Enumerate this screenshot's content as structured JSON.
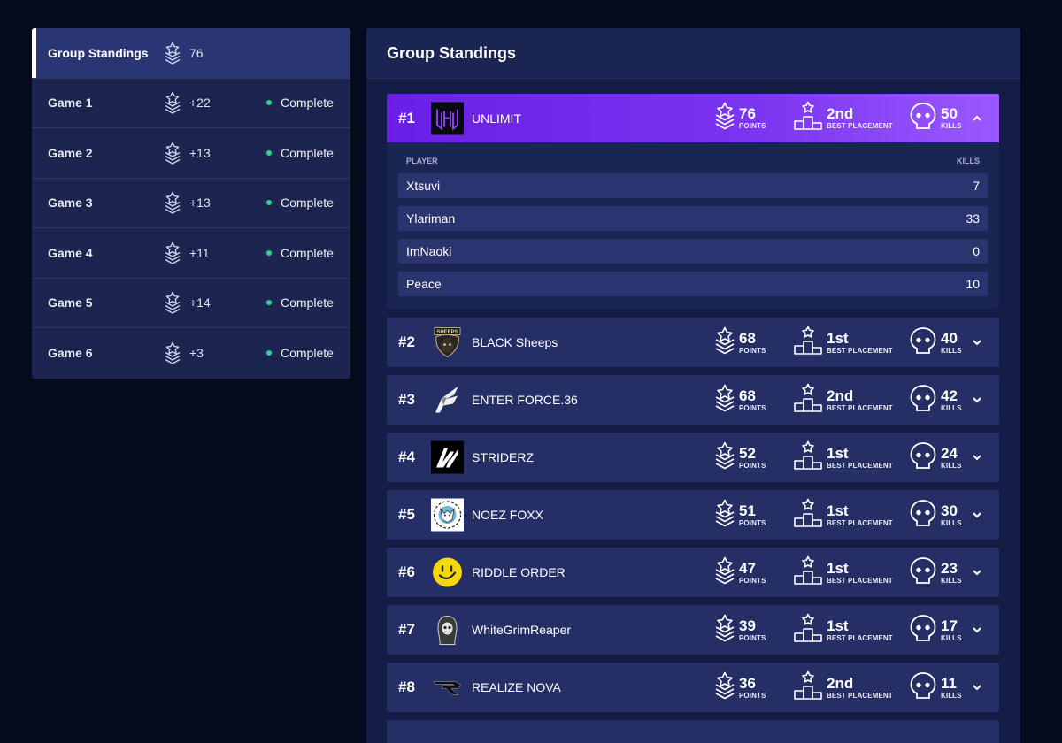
{
  "sidebar": {
    "items": [
      {
        "label": "Group Standings",
        "points": "76",
        "status": ""
      },
      {
        "label": "Game 1",
        "points": "+22",
        "status": "Complete"
      },
      {
        "label": "Game 2",
        "points": "+13",
        "status": "Complete"
      },
      {
        "label": "Game 3",
        "points": "+13",
        "status": "Complete"
      },
      {
        "label": "Game 4",
        "points": "+11",
        "status": "Complete"
      },
      {
        "label": "Game 5",
        "points": "+14",
        "status": "Complete"
      },
      {
        "label": "Game 6",
        "points": "+3",
        "status": "Complete"
      }
    ]
  },
  "main": {
    "title": "Group Standings",
    "labels": {
      "points": "POINTS",
      "best_placement": "BEST PLACEMENT",
      "kills": "KILLS",
      "player": "PLAYER",
      "player_kills": "KILLS"
    },
    "teams": [
      {
        "rank": "#1",
        "name": "UNLIMIT",
        "points": "76",
        "placement": "2nd",
        "kills": "50",
        "logo": "unlimit-logo"
      },
      {
        "rank": "#2",
        "name": "BLACK Sheeps",
        "points": "68",
        "placement": "1st",
        "kills": "40",
        "logo": "black-sheeps-logo"
      },
      {
        "rank": "#3",
        "name": "ENTER FORCE.36",
        "points": "68",
        "placement": "2nd",
        "kills": "42",
        "logo": "enter-force-logo"
      },
      {
        "rank": "#4",
        "name": "STRIDERZ",
        "points": "52",
        "placement": "1st",
        "kills": "24",
        "logo": "striderz-logo"
      },
      {
        "rank": "#5",
        "name": "NOEZ FOXX",
        "points": "51",
        "placement": "1st",
        "kills": "30",
        "logo": "noez-foxx-logo"
      },
      {
        "rank": "#6",
        "name": "RIDDLE ORDER",
        "points": "47",
        "placement": "1st",
        "kills": "23",
        "logo": "riddle-order-logo"
      },
      {
        "rank": "#7",
        "name": "WhiteGrimReaper",
        "points": "39",
        "placement": "1st",
        "kills": "17",
        "logo": "white-grim-reaper-logo"
      },
      {
        "rank": "#8",
        "name": "REALIZE NOVA",
        "points": "36",
        "placement": "2nd",
        "kills": "11",
        "logo": "realize-nova-logo"
      }
    ],
    "expanded_players": [
      {
        "name": "Xtsuvi",
        "kills": "7"
      },
      {
        "name": "Ylariman",
        "kills": "33"
      },
      {
        "name": "ImNaoki",
        "kills": "0"
      },
      {
        "name": "Peace",
        "kills": "10"
      }
    ]
  },
  "colors": {
    "accent_purple": "#6a1fe6",
    "status_green": "#2bd68a",
    "background": "#050b1d"
  }
}
